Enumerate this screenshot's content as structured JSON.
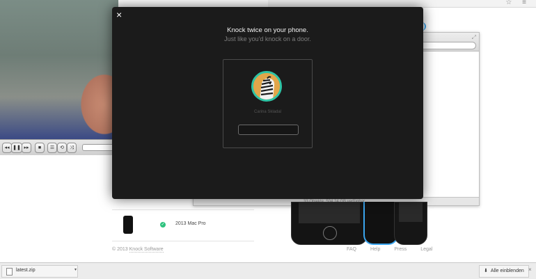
{
  "colors": {
    "modal_bg": "#1b1b1b",
    "avatar_ring": "#2ec4a5",
    "check": "#2ec27e",
    "phone_accent": "#3aa6f0"
  },
  "modal": {
    "close_icon": "×",
    "title": "Knock twice on your phone.",
    "subtitle": "Just like you'd knock on a door.",
    "profile": {
      "avatar_icon": "zebra-avatar-icon",
      "name": "Carina Skladal",
      "input_value": ""
    }
  },
  "background_page": {
    "device": {
      "name": "2013 Mac Pro",
      "check_icon": "✓"
    },
    "footer": {
      "copyright_prefix": "© 2013",
      "brand": "Knock Software",
      "links": [
        "FAQ",
        "Help",
        "Press",
        "Legal"
      ]
    },
    "finder_status": "33 Objekte, 504,24 GB verfügbar"
  },
  "video_player": {
    "controls": [
      "◂◂",
      "❚❚",
      "▸▸",
      "■",
      "☰",
      "⟲",
      "⤨"
    ]
  },
  "download_bar": {
    "file_name": "latest.zip",
    "menu_icon": "▾",
    "show_all_icon": "⬇",
    "show_all_label": "Alle einblenden",
    "close_icon": "×"
  }
}
